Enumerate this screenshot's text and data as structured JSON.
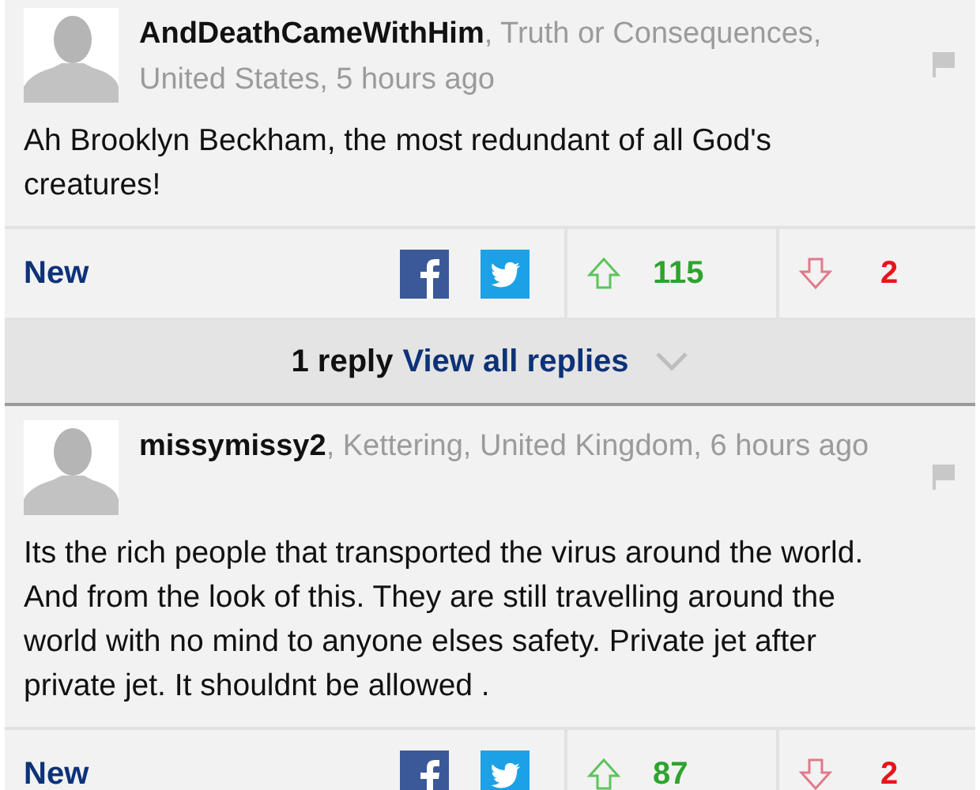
{
  "comments": [
    {
      "byline": "**AndDeathCameWithHim**, Truth or Consequences, United States, 5 hours ago",
      "text": "Ah Brooklyn Beckham, the most redundant of all God's creatures!",
      "label": "New",
      "upvotes": "115",
      "downvotes": "2",
      "replies": {
        "count": "1 reply",
        "link": "View all replies"
      }
    },
    {
      "byline": "**missymissy2**, Kettering, United Kingdom, 6 hours ago",
      "text": "Its the rich people that transported the virus around the world. And from the look of this. They are still travelling around the world with no mind to anyone elses safety. Private jet after private jet. It shouldnt be allowed .",
      "label": "New",
      "upvotes": "87",
      "downvotes": "2"
    }
  ]
}
